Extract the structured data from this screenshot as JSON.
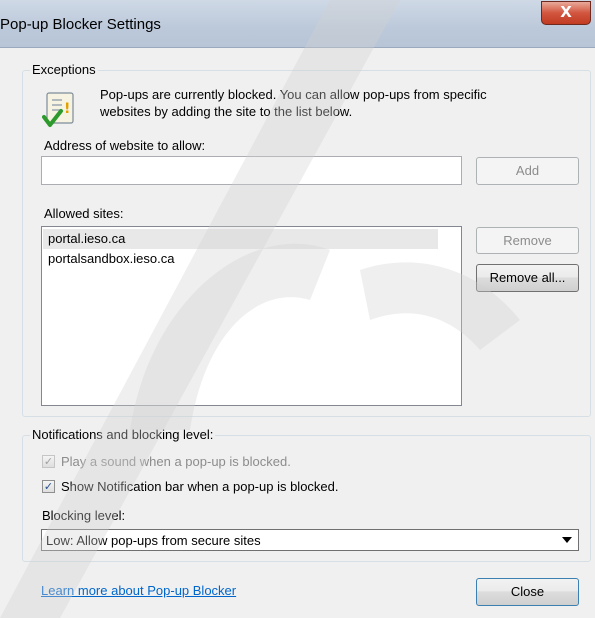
{
  "window": {
    "title": "Pop-up Blocker Settings",
    "close_glyph": "X"
  },
  "exceptions": {
    "group_label": "Exceptions",
    "info_text": "Pop-ups are currently blocked.  You can allow pop-ups from specific websites by adding the site to the list below.",
    "icon": "info-checklist-icon",
    "address_label": "Address of website to allow:",
    "address_value": "",
    "add_label": "Add",
    "allowed_label": "Allowed sites:",
    "allowed_sites": [
      "portal.ieso.ca",
      "portalsandbox.ieso.ca"
    ],
    "remove_label": "Remove",
    "remove_all_label": "Remove all..."
  },
  "notifications": {
    "group_label": "Notifications and blocking level:",
    "play_sound_label": "Play a sound when a pop-up is blocked.",
    "play_sound_checked": true,
    "show_bar_label": "Show Notification bar when a pop-up is blocked.",
    "show_bar_checked": true,
    "blocking_label": "Blocking level:",
    "blocking_value": "Low: Allow pop-ups from secure sites"
  },
  "footer": {
    "learn_more": "Learn more about Pop-up Blocker",
    "close_label": "Close"
  },
  "colors": {
    "link": "#0066cc",
    "close_button": "#c13b21",
    "check_mark": "#2a4f8f"
  }
}
